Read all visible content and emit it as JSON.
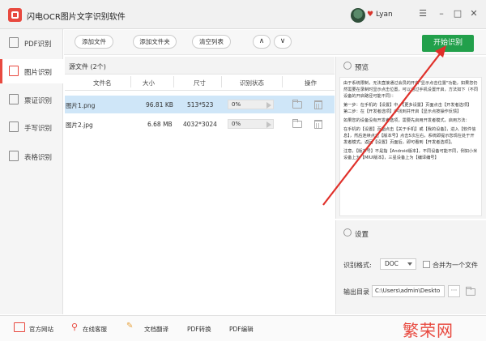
{
  "window": {
    "title": "闪电OCR图片文字识别软件",
    "username": "Lyan",
    "minimize": "–",
    "restore": "□",
    "close": "✕",
    "menu": "☰"
  },
  "sidebar": {
    "items": [
      {
        "label": "PDF识别",
        "icon": "pdf-icon",
        "active": false
      },
      {
        "label": "图片识别",
        "icon": "image-icon",
        "active": true
      },
      {
        "label": "票证识别",
        "icon": "ticket-icon",
        "active": false
      },
      {
        "label": "手写识别",
        "icon": "handwriting-icon",
        "active": false
      },
      {
        "label": "表格识别",
        "icon": "table-icon",
        "active": false
      }
    ]
  },
  "toolbar": {
    "add_file": "添加文件",
    "add_folder": "添加文件夹",
    "clear_list": "清空列表",
    "up": "∧",
    "down": "∨",
    "start": "开始识别"
  },
  "filelist": {
    "title": "源文件 (2个)",
    "columns": [
      "文件名",
      "大小",
      "尺寸",
      "识别状态",
      "操作"
    ],
    "rows": [
      {
        "name": "图片1.png",
        "size": "96.81 KB",
        "dims": "513*523",
        "progress": "0%",
        "selected": true
      },
      {
        "name": "图片2.jpg",
        "size": "6.68 MB",
        "dims": "4032*3024",
        "progress": "0%",
        "selected": false
      }
    ]
  },
  "preview": {
    "title": "预览",
    "paragraphs": [
      "由于系统限制，无法直接通过会员的开启\"显示点击位置\"功能，如果您仍然需要在录制时显示点击位置，可以通过手机设置开启，方法如下（不同设备的开启路径可能不同）：",
      "第一步：在手机的【设置】中，【更多设置】页面点击【开发者选项】\n第二步：在【开发者选项】中找到并开启【显示点按操作反馈】",
      "如果您的设备没有开发者选项，需要先启用开发者模式，启用方法：",
      "在手机的【设置】页面点击【关于手机】或【我的设备】，进入【软件信息】，然后连续点击【版本号】点击5次左右，系统即提示您现在处于开发者模式。返回【设置】页面后，即可看到【开发者选项】。",
      "注意，【版本号】不是指【Android版本】，不同设备可能不同，例如小米设备上为【MIUI版本】，三星设备上为【编译编号】"
    ]
  },
  "settings": {
    "title": "设置",
    "format_label": "识别格式:",
    "format_value": "DOC",
    "merge_label": "合并为一个文件",
    "output_label": "输出目录",
    "output_path": "C:\\Users\\admin\\Deskto",
    "browse": "···"
  },
  "bottombar": {
    "site": "官方网站",
    "service": "在线客服",
    "translate": "文档翻译",
    "pdf_convert": "PDF转换",
    "pdf_edit": "PDF编辑"
  },
  "watermark": "繁荣网",
  "colors": {
    "accent": "#e8493f",
    "start_button": "#22a04b",
    "selected_row": "#cfe6f8",
    "annotation_arrow": "#e0302a"
  }
}
